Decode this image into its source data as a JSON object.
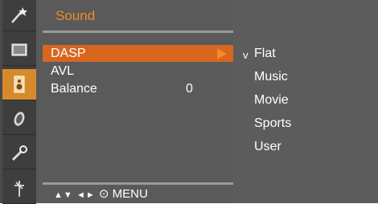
{
  "menu": {
    "title": "Sound",
    "items": [
      {
        "label": "DASP",
        "value": "",
        "selected": true
      },
      {
        "label": "AVL",
        "value": ""
      },
      {
        "label": "Balance",
        "value": "0"
      }
    ],
    "nav_hint": {
      "up_down": "▲▼",
      "left_right": "◄►",
      "ok": "⊙",
      "menu": "MENU"
    }
  },
  "submenu": {
    "check": "v",
    "items": [
      "Flat",
      "Music",
      "Movie",
      "Sports",
      "User"
    ],
    "checked_index": 0
  },
  "iconbar": {
    "items": [
      {
        "name": "picture-wand-icon"
      },
      {
        "name": "screen-icon"
      },
      {
        "name": "speaker-icon",
        "active": true
      },
      {
        "name": "clock-icon"
      },
      {
        "name": "option-key-icon"
      },
      {
        "name": "station-antenna-icon"
      }
    ]
  },
  "colors": {
    "accent": "#f08a2a",
    "selected_bg": "#d9661f",
    "active_icon_bg": "#d68a2c"
  }
}
